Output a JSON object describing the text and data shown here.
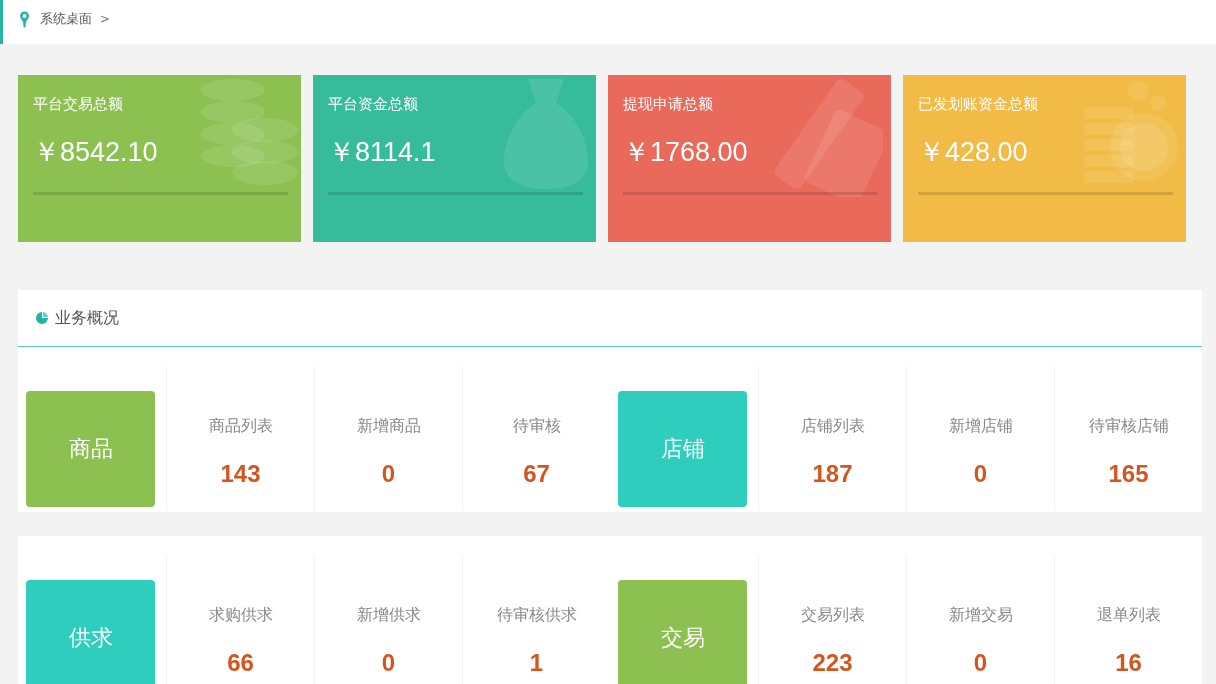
{
  "breadcrumb": {
    "label": "系统桌面",
    "separator": ">"
  },
  "stat_cards": [
    {
      "title": "平台交易总额",
      "amount": "￥8542.10",
      "color": "#8cc152"
    },
    {
      "title": "平台资金总额",
      "amount": "￥8114.1",
      "color": "#37bc9b"
    },
    {
      "title": "提现申请总额",
      "amount": "￥1768.00",
      "color": "#e9695a"
    },
    {
      "title": "已发划账资金总额",
      "amount": "￥428.00",
      "color": "#f1bb45"
    }
  ],
  "overview": {
    "title": "业务概况",
    "rows": [
      {
        "groups": [
          {
            "category": "商品",
            "color": "#8cc152",
            "stats": [
              {
                "label": "商品列表",
                "value": "143"
              },
              {
                "label": "新增商品",
                "value": "0"
              },
              {
                "label": "待审核",
                "value": "67"
              }
            ]
          },
          {
            "category": "店铺",
            "color": "#2ecdbd",
            "stats": [
              {
                "label": "店铺列表",
                "value": "187"
              },
              {
                "label": "新增店铺",
                "value": "0"
              },
              {
                "label": "待审核店铺",
                "value": "165"
              }
            ]
          }
        ]
      },
      {
        "groups": [
          {
            "category": "供求",
            "color": "#2ecdbd",
            "stats": [
              {
                "label": "求购供求",
                "value": "66"
              },
              {
                "label": "新增供求",
                "value": "0"
              },
              {
                "label": "待审核供求",
                "value": "1"
              }
            ]
          },
          {
            "category": "交易",
            "color": "#8cc152",
            "stats": [
              {
                "label": "交易列表",
                "value": "223"
              },
              {
                "label": "新增交易",
                "value": "0"
              },
              {
                "label": "退单列表",
                "value": "16"
              }
            ]
          }
        ]
      }
    ]
  }
}
